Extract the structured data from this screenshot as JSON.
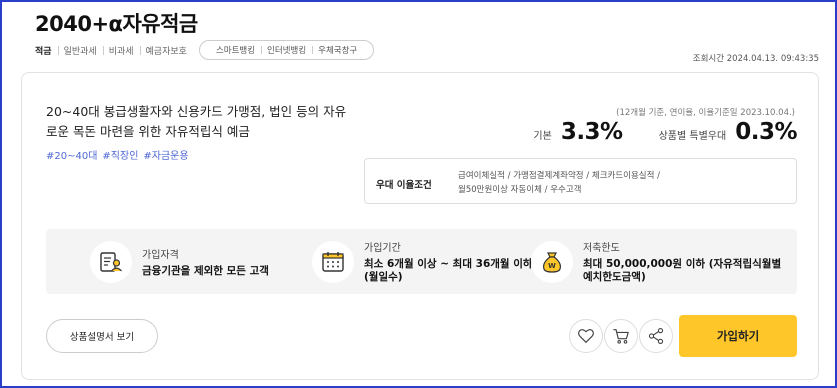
{
  "product": {
    "title": "2040+α자유적금",
    "tags": [
      "적금",
      "일반과세",
      "비과세",
      "예금자보호"
    ],
    "channels": [
      "스마트뱅킹",
      "인터넷뱅킹",
      "우체국창구"
    ],
    "lookup_time": "조회시간 2024.04.13. 09:43:35"
  },
  "summary": {
    "description": "20~40대 봉급생활자와 신용카드 가맹점, 법인 등의 자유로운 목돈 마련을 위한 자유적립식 예금",
    "hashtags": [
      "#20~40대",
      "#직장인",
      "#자금운용"
    ],
    "basis": "(12개월 기준, 연이율, 이율기준일 2023.10.04.)",
    "base_rate_label": "기본",
    "base_rate": "3.3%",
    "special_rate_label": "상품별 특별우대",
    "special_rate": "0.3%"
  },
  "preference": {
    "label": "우대 이율조건",
    "items": [
      "급여이체실적",
      "가맹점결제계좌약정",
      "체크카드이용실적",
      "월50만원이상 자동이체",
      "우수고객"
    ]
  },
  "info": [
    {
      "icon": "document-person-icon",
      "label": "가입자격",
      "value": "금융기관을 제외한 모든 고객"
    },
    {
      "icon": "calendar-icon",
      "label": "가입기간",
      "value": "최소 6개월 이상 ~ 최대 36개월 이하(월일수)"
    },
    {
      "icon": "money-bag-icon",
      "label": "저축한도",
      "value": "최대 50,000,000원 이하 (자유적립식월별예치한도금액)"
    }
  ],
  "actions": {
    "manual_label": "상품설명서 보기",
    "join_label": "가입하기",
    "icons": [
      "heart-icon",
      "cart-icon",
      "share-icon"
    ]
  },
  "colors": {
    "accent": "#ffc629",
    "hashtag": "#5068d4",
    "frame": "#2b3ec9"
  }
}
